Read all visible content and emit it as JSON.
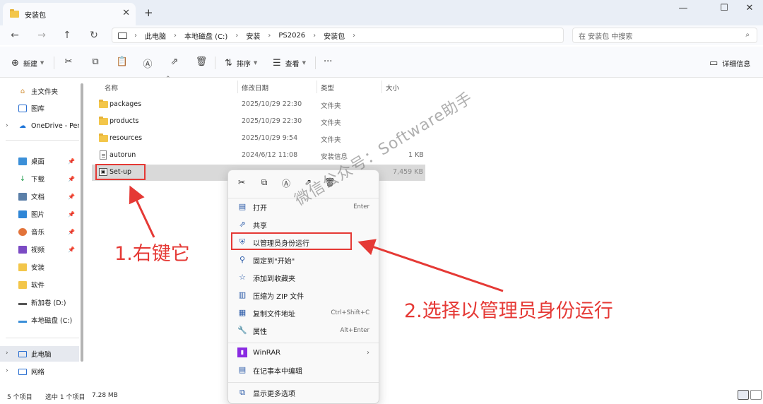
{
  "tab": {
    "title": "安装包",
    "close": "✕",
    "new": "+"
  },
  "window": {
    "minimize": "—",
    "maximize": "☐",
    "close": "✕"
  },
  "nav": {
    "back": "←",
    "forward": "→",
    "up": "↑",
    "refresh": "↻"
  },
  "breadcrumb": [
    "此电脑",
    "本地磁盘 (C:)",
    "安装",
    "PS2026",
    "安装包"
  ],
  "search": {
    "placeholder": "在 安装包 中搜索",
    "icon": "search-icon"
  },
  "toolbar": {
    "new_label": "新建",
    "sort_label": "排序",
    "view_label": "查看",
    "more": "···",
    "details_label": "详细信息"
  },
  "sidebar": {
    "items": [
      {
        "label": "主文件夹",
        "icon": "home-icon"
      },
      {
        "label": "图库",
        "icon": "gallery-icon"
      },
      {
        "label": "OneDrive - Per",
        "icon": "cloud-icon"
      },
      {
        "label": "桌面",
        "icon": "desktop-icon"
      },
      {
        "label": "下载",
        "icon": "download-icon"
      },
      {
        "label": "文档",
        "icon": "document-icon"
      },
      {
        "label": "图片",
        "icon": "picture-icon"
      },
      {
        "label": "音乐",
        "icon": "music-icon"
      },
      {
        "label": "视频",
        "icon": "video-icon"
      },
      {
        "label": "安装",
        "icon": "folder-icon"
      },
      {
        "label": "软件",
        "icon": "folder-icon"
      },
      {
        "label": "新加卷 (D:)",
        "icon": "drive-icon"
      },
      {
        "label": "本地磁盘 (C:)",
        "icon": "drive-icon"
      },
      {
        "label": "此电脑",
        "icon": "pc-icon"
      },
      {
        "label": "网络",
        "icon": "network-icon"
      }
    ]
  },
  "columns": {
    "name": "名称",
    "date": "修改日期",
    "type": "类型",
    "size": "大小"
  },
  "files": [
    {
      "name": "packages",
      "date": "2025/10/29 22:30",
      "type": "文件夹",
      "size": ""
    },
    {
      "name": "products",
      "date": "2025/10/29 22:30",
      "type": "文件夹",
      "size": ""
    },
    {
      "name": "resources",
      "date": "2025/10/29 9:54",
      "type": "文件夹",
      "size": ""
    },
    {
      "name": "autorun",
      "date": "2024/6/12 11:08",
      "type": "安装信息",
      "size": "1 KB"
    },
    {
      "name": "Set-up",
      "date": "",
      "type": "",
      "size": "7,459 KB"
    }
  ],
  "context_menu": {
    "items": [
      {
        "label": "打开",
        "accel": "Enter"
      },
      {
        "label": "共享",
        "accel": ""
      },
      {
        "label": "以管理员身份运行",
        "accel": ""
      },
      {
        "label": "固定到\"开始\"",
        "accel": ""
      },
      {
        "label": "添加到收藏夹",
        "accel": ""
      },
      {
        "label": "压缩为 ZIP 文件",
        "accel": ""
      },
      {
        "label": "复制文件地址",
        "accel": "Ctrl+Shift+C"
      },
      {
        "label": "属性",
        "accel": "Alt+Enter"
      },
      {
        "label": "WinRAR",
        "accel": ""
      },
      {
        "label": "在记事本中编辑",
        "accel": ""
      },
      {
        "label": "显示更多选项",
        "accel": ""
      }
    ]
  },
  "annotations": {
    "step1": "1.右键它",
    "step2": "2.选择以管理员身份运行",
    "watermark": "微信公众号：Software助手"
  },
  "status": {
    "count": "5 个项目",
    "selected": "选中 1 个项目",
    "size": "7.28 MB"
  },
  "colors": {
    "highlight": "#e53935",
    "accent": "#2a5aa8",
    "folder": "#f3c64a"
  }
}
